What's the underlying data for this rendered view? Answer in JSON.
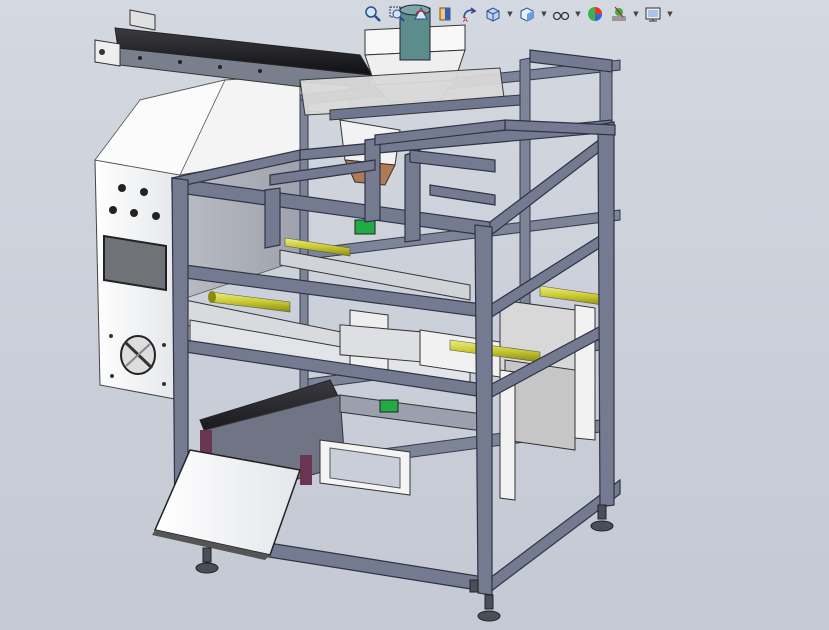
{
  "window": {
    "type": "solidworks-graphics-area"
  },
  "heads_up_toolbar": {
    "items": [
      {
        "icon": "zoom-to-fit-icon",
        "has_dropdown": false
      },
      {
        "icon": "zoom-to-area-icon",
        "has_dropdown": false
      },
      {
        "icon": "previous-view-icon",
        "has_dropdown": false
      },
      {
        "icon": "section-view-icon",
        "has_dropdown": false
      },
      {
        "icon": "dynamic-annotation-icon",
        "has_dropdown": false
      },
      {
        "icon": "view-orientation-icon",
        "has_dropdown": true
      },
      {
        "icon": "display-style-icon",
        "has_dropdown": true
      },
      {
        "icon": "hide-show-items-icon",
        "has_dropdown": true
      },
      {
        "icon": "edit-appearance-icon",
        "has_dropdown": false
      },
      {
        "icon": "apply-scene-icon",
        "has_dropdown": true
      },
      {
        "icon": "view-settings-icon",
        "has_dropdown": true
      }
    ]
  },
  "colors": {
    "background": "#c9ced8",
    "frame": "#6f7890",
    "frame_dark": "#3c4256",
    "panel": "#f2f2f2",
    "belt": "#1e1e22",
    "cylinder": "#c8c832",
    "sensor_green": "#22aa44",
    "motor_teal": "#5c8c8c"
  },
  "model": {
    "name": "packaging-machine-assembly"
  }
}
